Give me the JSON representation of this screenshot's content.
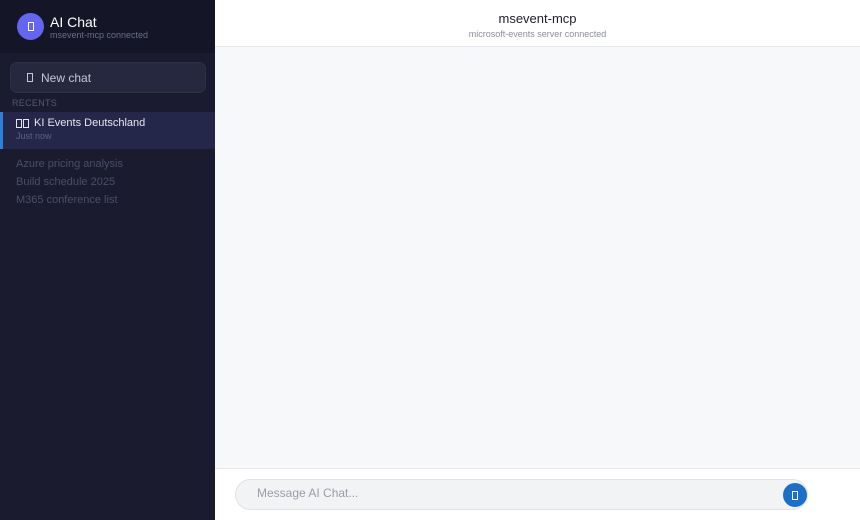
{
  "brand": {
    "title": "AI Chat",
    "subtitle": "msevent-mcp connected",
    "logo_icon": "chat-bubble-icon"
  },
  "sidebar": {
    "new_chat_label": "New chat",
    "new_chat_icon": "plus-icon",
    "recents_label": "RECENTS",
    "active_chat": {
      "title": "KI Events Deutschland",
      "flag_icon": "germany-flag-icon",
      "time": "Just now"
    },
    "chats": [
      {
        "label": "Azure pricing analysis"
      },
      {
        "label": "Build schedule 2025"
      },
      {
        "label": "M365 conference list"
      }
    ]
  },
  "header": {
    "title": "msevent-mcp",
    "subtitle": "microsoft-events server connected"
  },
  "composer": {
    "placeholder": "Message AI Chat...",
    "value": "",
    "send_icon": "send-icon"
  },
  "colors": {
    "sidebar_bg": "#1a1b2e",
    "accent": "#6366f1",
    "active_border": "#2f7fd8",
    "send_button": "#1a6fc9",
    "main_bg": "#f7f8fa"
  }
}
